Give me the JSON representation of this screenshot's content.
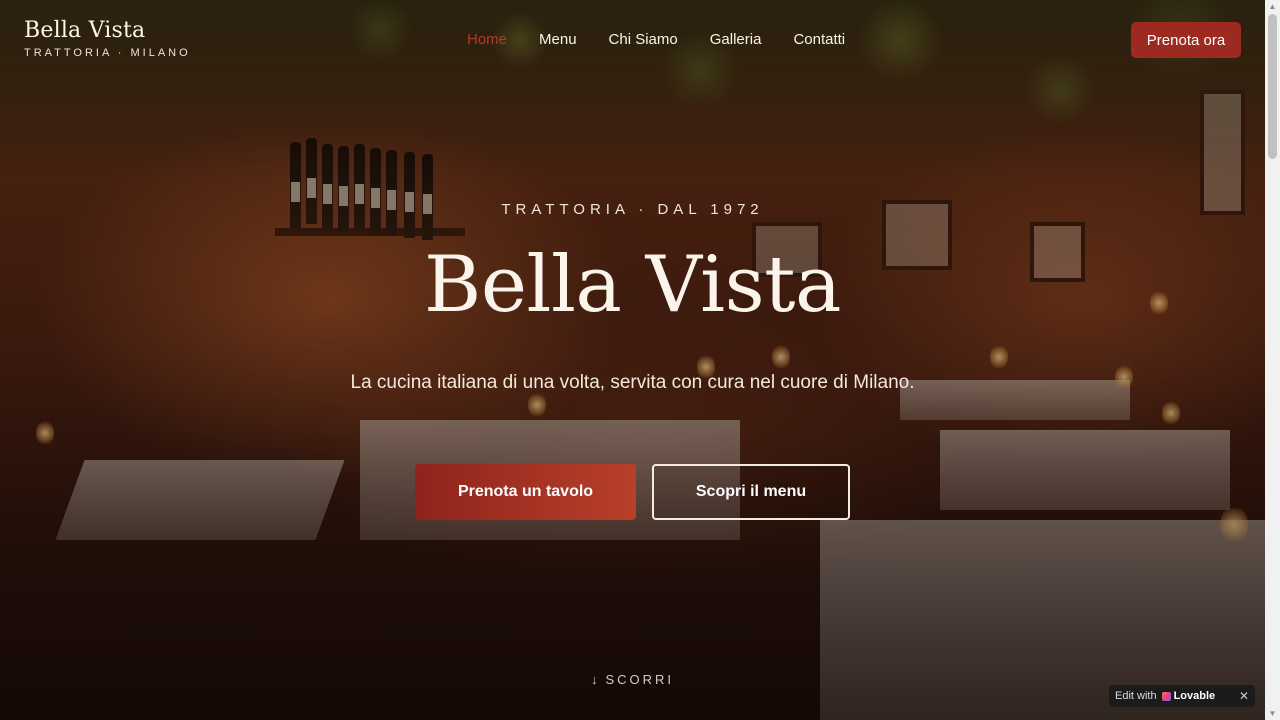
{
  "header": {
    "brand_name": "Bella Vista",
    "brand_sub": "TRATTORIA · MILANO",
    "nav": [
      {
        "label": "Home",
        "active": true
      },
      {
        "label": "Menu",
        "active": false
      },
      {
        "label": "Chi Siamo",
        "active": false
      },
      {
        "label": "Galleria",
        "active": false
      },
      {
        "label": "Contatti",
        "active": false
      }
    ],
    "cta_label": "Prenota ora"
  },
  "hero": {
    "eyebrow": "TRATTORIA · DAL 1972",
    "title": "Bella Vista",
    "subtitle": "La cucina italiana di una volta, servita con cura nel cuore di Milano.",
    "primary_button": "Prenota un tavolo",
    "secondary_button": "Scopri il menu",
    "scroll_hint": "SCORRI",
    "scroll_arrow": "↓"
  },
  "badge": {
    "prefix": "Edit with",
    "brand": "Lovable",
    "close": "✕"
  },
  "colors": {
    "accent": "#9c2a20",
    "active_nav": "#b33a26",
    "text_light": "#fbf4ea"
  }
}
